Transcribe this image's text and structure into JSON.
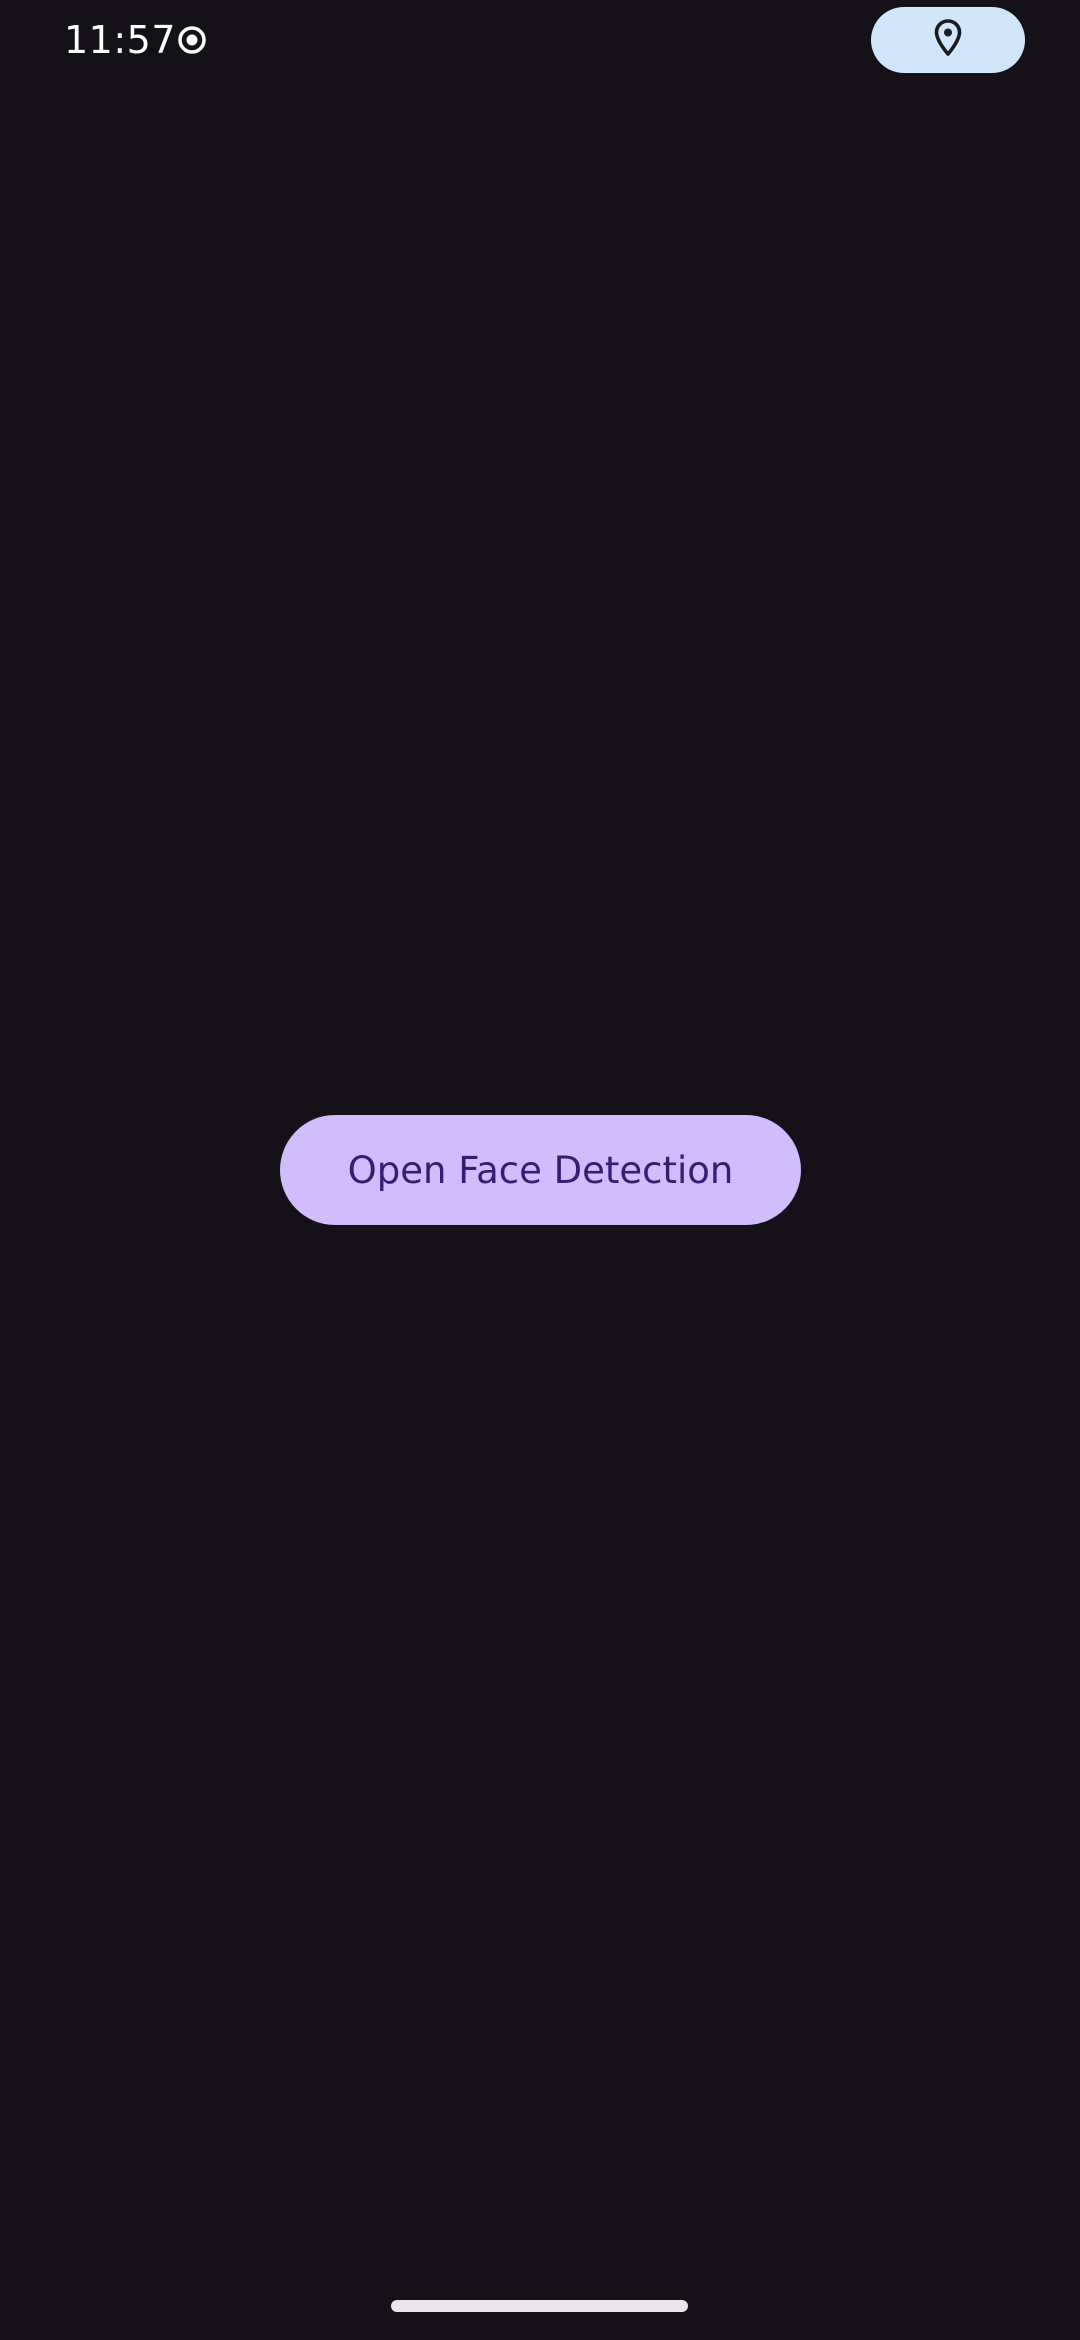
{
  "status_bar": {
    "time": "11:57",
    "record_icon": "record-icon",
    "location_icon": "location-pin-icon",
    "location_chip_color": "#d2e6fb"
  },
  "main": {
    "open_face_detection_label": "Open Face Detection",
    "button_color": "#d1bcfc",
    "button_text_color": "#371e73"
  },
  "system": {
    "home_indicator": "home-indicator"
  },
  "colors": {
    "background": "#141118"
  }
}
